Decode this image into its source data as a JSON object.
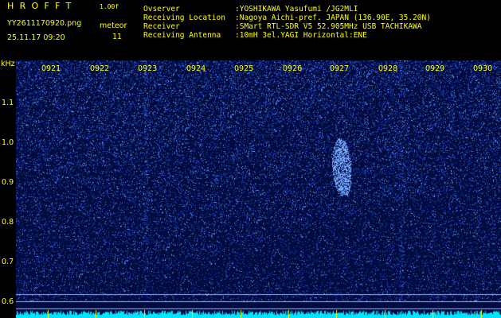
{
  "header": {
    "app_name": "HROFFT",
    "version": "1.00f",
    "filename": "YY2611170920.png",
    "datetime": "25.11.17 09:20",
    "meteor_label": "meteor",
    "meteor_count": "11"
  },
  "info": [
    {
      "label": "Ovserver",
      "value": ":YOSHIKAWA Yasufumi /JG2MLI"
    },
    {
      "label": "Receiving Location",
      "value": ":Nagoya Aichi-pref. JAPAN (136.90E, 35.20N)"
    },
    {
      "label": "Receiver",
      "value": ":SMart RTL-SDR V5 52.905MHz USB TACHIKAWA"
    },
    {
      "label": "Receiving Antenna",
      "value": ":10mH 3el.YAGI Horizontal:ENE"
    }
  ],
  "axis": {
    "unit": "kHz",
    "freq_ticks": [
      "1.1",
      "1.0",
      "0.9",
      "0.8",
      "0.7",
      "0.6"
    ],
    "time_ticks": [
      "0921",
      "0922",
      "0923",
      "0924",
      "0925",
      "0926",
      "0927",
      "0928",
      "0929",
      "0930"
    ]
  },
  "colors": {
    "text": "#ffff00",
    "background": "#000000",
    "spectrum_bg": "#000b40",
    "noise": "#3a6cff",
    "baseline": "#00e5ff"
  }
}
